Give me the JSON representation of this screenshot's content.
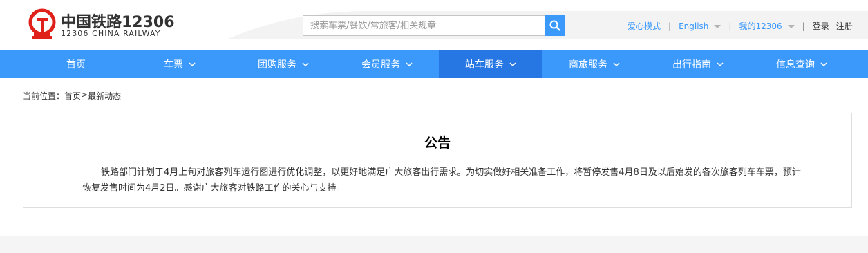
{
  "brand": {
    "name_cn": "中国铁路12306",
    "name_en": "12306 CHINA RAILWAY"
  },
  "search": {
    "placeholder": "搜索车票/餐饮/常旅客/相关规章"
  },
  "top_links": {
    "care_mode": "爱心模式",
    "language": "English",
    "my_account": "我的12306",
    "login": "登录",
    "register": "注册"
  },
  "nav": {
    "items": [
      {
        "label": "首页",
        "has_dropdown": false,
        "active": false
      },
      {
        "label": "车票",
        "has_dropdown": true,
        "active": false
      },
      {
        "label": "团购服务",
        "has_dropdown": true,
        "active": false
      },
      {
        "label": "会员服务",
        "has_dropdown": true,
        "active": false
      },
      {
        "label": "站车服务",
        "has_dropdown": true,
        "active": true
      },
      {
        "label": "商旅服务",
        "has_dropdown": true,
        "active": false
      },
      {
        "label": "出行指南",
        "has_dropdown": true,
        "active": false
      },
      {
        "label": "信息查询",
        "has_dropdown": true,
        "active": false
      }
    ]
  },
  "breadcrumb": {
    "prefix": "当前位置：",
    "home": "首页",
    "sep": ">",
    "current": "最新动态"
  },
  "notice": {
    "title": "公告",
    "body": "铁路部门计划于4月上旬对旅客列车运行图进行优化调整，以更好地满足广大旅客出行需求。为切实做好相关准备工作，将暂停发售4月8日及以后始发的各次旅客列车车票，预计恢复发售时间为4月2日。感谢广大旅客对铁路工作的关心与支持。"
  },
  "colors": {
    "primary": "#3b99fc",
    "nav_active": "#2676e3",
    "logo_red": "#e0201a"
  }
}
